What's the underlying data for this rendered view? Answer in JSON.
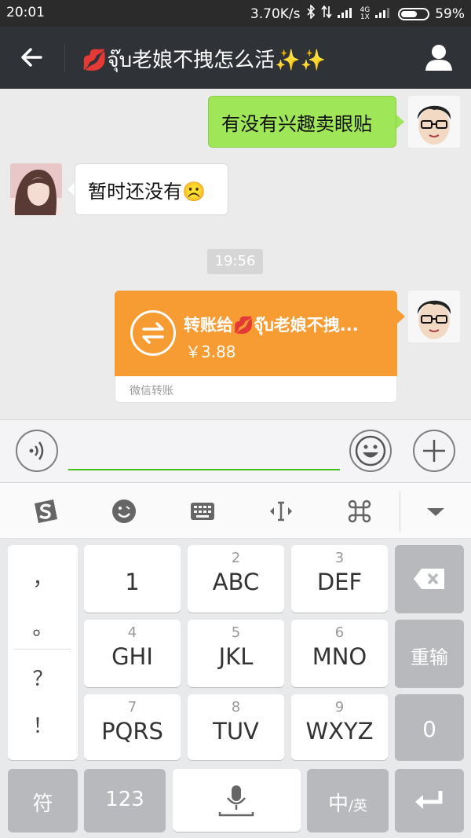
{
  "status_bar": {
    "time": "20:01",
    "net_speed": "3.70K/s",
    "net_type_top": "4G",
    "net_type_bottom": "1X",
    "battery": "59%"
  },
  "title_bar": {
    "title": "💋จุ๊บ老娘不拽怎么活✨✨",
    "back_icon": "arrow-left-icon",
    "profile_icon": "person-icon"
  },
  "chat": {
    "messages": [
      {
        "side": "right",
        "text": "有没有兴趣卖眼贴"
      },
      {
        "side": "left",
        "text": "暂时还没有☹️"
      }
    ],
    "timestamp": "19:56",
    "transfer": {
      "title": "转账给💋จุ๊บ老娘不拽...",
      "amount": "￥3.88",
      "footer": "微信转账"
    }
  },
  "colors": {
    "title_bg": "#2f3236",
    "bubble_green": "#9fe658",
    "transfer_orange": "#f79b33",
    "input_underline": "#45c01a"
  },
  "keyboard": {
    "punctuation": [
      "，",
      "。",
      "？",
      "！"
    ],
    "keys": [
      {
        "num": "",
        "letters": "1"
      },
      {
        "num": "2",
        "letters": "ABC"
      },
      {
        "num": "3",
        "letters": "DEF"
      },
      {
        "num": "4",
        "letters": "GHI"
      },
      {
        "num": "5",
        "letters": "JKL"
      },
      {
        "num": "6",
        "letters": "MNO"
      },
      {
        "num": "7",
        "letters": "PQRS"
      },
      {
        "num": "8",
        "letters": "TUV"
      },
      {
        "num": "9",
        "letters": "WXYZ"
      }
    ],
    "reenter": "重输",
    "zero": "0",
    "symbols": "符",
    "numbers": "123",
    "lang_main": "中",
    "lang_alt": "/英"
  }
}
